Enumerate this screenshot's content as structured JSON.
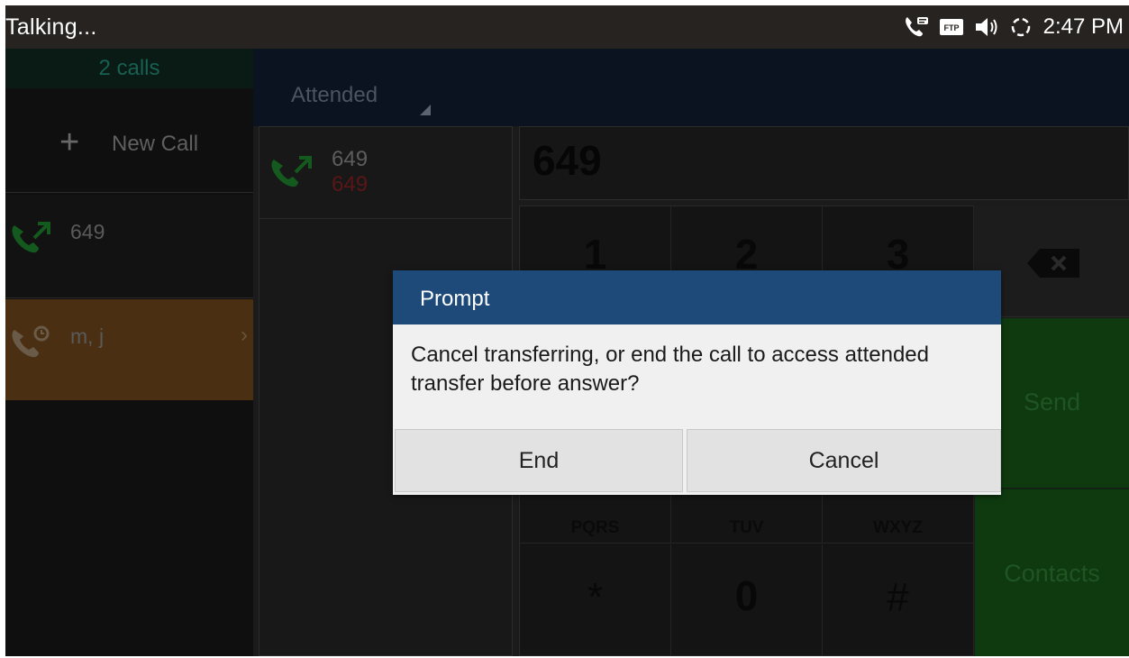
{
  "status_bar": {
    "title": "Talking...",
    "time": "2:47 PM",
    "icons": [
      "call-forward-icon",
      "ftp-icon",
      "speaker-icon",
      "sync-icon"
    ],
    "ftp_label": "FTP"
  },
  "left_panel": {
    "calls_count": "2 calls",
    "new_call_label": "New Call",
    "calls": [
      {
        "name": "649",
        "icon": "active-call-icon"
      },
      {
        "name": "m, j",
        "icon": "held-call-icon",
        "chevron": "›"
      }
    ]
  },
  "header": {
    "transfer_mode": "Attended"
  },
  "call_list": {
    "line1": "649",
    "line2": "649"
  },
  "dial_display": {
    "number": "649"
  },
  "keypad": {
    "keys": [
      {
        "digit": "1",
        "letters": ""
      },
      {
        "digit": "2",
        "letters": ""
      },
      {
        "digit": "3",
        "letters": ""
      },
      {
        "digit": "",
        "letters": "PQRS"
      },
      {
        "digit": "",
        "letters": "TUV"
      },
      {
        "digit": "",
        "letters": "WXYZ"
      },
      {
        "digit": "*",
        "letters": ""
      },
      {
        "digit": "0",
        "letters": ""
      },
      {
        "digit": "#",
        "letters": ""
      }
    ]
  },
  "actions": {
    "send": "Send",
    "contacts": "Contacts"
  },
  "dialog": {
    "title": "Prompt",
    "message": "Cancel transferring, or end the call to access attended transfer before answer?",
    "end_button": "End",
    "cancel_button": "Cancel"
  },
  "colors": {
    "dialog_header": "#1e4a7a",
    "send_green": "#0f3a10",
    "held_orange": "#4a2f13",
    "missed_red": "#5a1616"
  }
}
